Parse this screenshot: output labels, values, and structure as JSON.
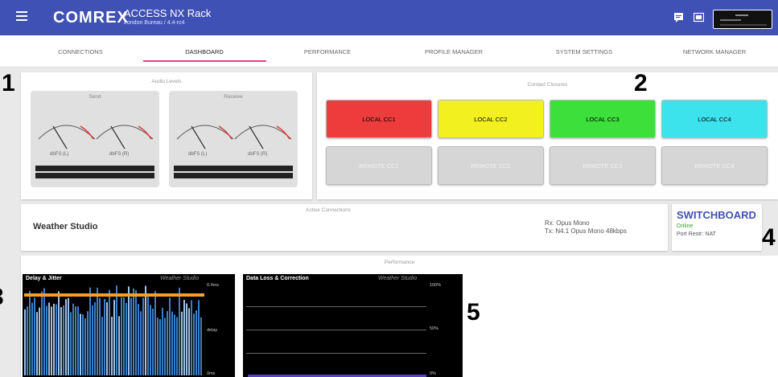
{
  "header": {
    "logo": "COMREX",
    "title": "ACCESS NX Rack",
    "subtitle": "London Bureau / 4.4-rc4",
    "icons": [
      "chat-icon",
      "card-icon"
    ]
  },
  "tabs": [
    {
      "label": "CONNECTIONS",
      "active": false
    },
    {
      "label": "DASHBOARD",
      "active": true
    },
    {
      "label": "PERFORMANCE",
      "active": false
    },
    {
      "label": "PROFILE MANAGER",
      "active": false
    },
    {
      "label": "SYSTEM SETTINGS",
      "active": false
    },
    {
      "label": "NETWORK MANAGER",
      "active": false
    }
  ],
  "callouts": [
    "1",
    "2",
    "3",
    "4",
    "5"
  ],
  "audio": {
    "title": "Audio Levels",
    "meters": [
      {
        "title": "Send",
        "left_label": "dbFS (L)",
        "right_label": "dbFS (R)"
      },
      {
        "title": "Receive",
        "left_label": "dbFS (L)",
        "right_label": "dbFS (R)"
      }
    ]
  },
  "closures": {
    "title": "Contact Closures",
    "local": [
      {
        "label": "LOCAL CC1",
        "color": "#ee3b3b"
      },
      {
        "label": "LOCAL CC2",
        "color": "#f3f01f"
      },
      {
        "label": "LOCAL CC3",
        "color": "#3ddf3b"
      },
      {
        "label": "LOCAL CC4",
        "color": "#3ce3ed"
      }
    ],
    "remote": [
      {
        "label": "REMOTE CC1"
      },
      {
        "label": "REMOTE CC2"
      },
      {
        "label": "REMOTE CC3"
      },
      {
        "label": "REMOTE CC4"
      }
    ]
  },
  "connections": {
    "title": "Active Connections",
    "name": "Weather Studio",
    "rx": "Rx: Opus Mono",
    "tx": "Tx: N4.1 Opus Mono 48kbps"
  },
  "switchboard": {
    "brand": "SWITCHBOARD",
    "status": "Online",
    "port": "Port Restr: NAT"
  },
  "performance": {
    "title": "Performance",
    "delay": {
      "title": "Delay & Jitter",
      "connection": "Weather Studio",
      "axis": [
        "0.4ms",
        "delay",
        "0ms"
      ]
    },
    "loss": {
      "title": "Data Loss & Correction",
      "connection": "Weather Studio",
      "axis": [
        "100%",
        "50%",
        "0%"
      ]
    }
  }
}
